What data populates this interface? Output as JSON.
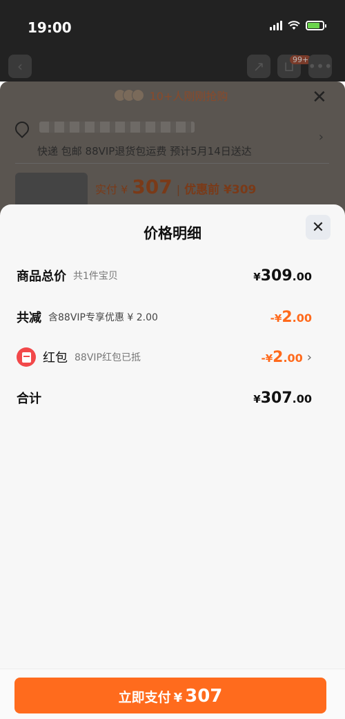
{
  "status_bar": {
    "time": "19:00"
  },
  "nav": {
    "cart_badge": "99+"
  },
  "background_sheet": {
    "rush_text": "10+人刚刚抢购",
    "shipping_text": "快递 包邮 88VIP退货包运费 预计5月14日送达",
    "actual_label": "实付 ¥",
    "actual_price": "307",
    "before_label": "优惠前 ¥309"
  },
  "sheet": {
    "title": "价格明细",
    "rows": {
      "total": {
        "title": "商品总价",
        "sub": "共1件宝贝",
        "cur": "¥",
        "int": "309",
        "dec": ".00"
      },
      "reduce": {
        "title": "共减",
        "sub": "含88VIP专享优惠 ¥ 2.00",
        "cur": "-¥",
        "int": "2",
        "dec": ".00"
      },
      "redpack": {
        "title": "红包",
        "sub": "88VIP红包已抵",
        "cur": "-¥",
        "int": "2",
        "dec": ".00"
      },
      "sum": {
        "title": "合计",
        "cur": "¥",
        "int": "307",
        "dec": ".00"
      }
    }
  },
  "pay": {
    "label": "立即支付",
    "cur": "¥",
    "amount": "307"
  },
  "colors": {
    "accent": "#ff6b1d",
    "discount": "#ff6a1c",
    "redpack": "#f2484a"
  }
}
